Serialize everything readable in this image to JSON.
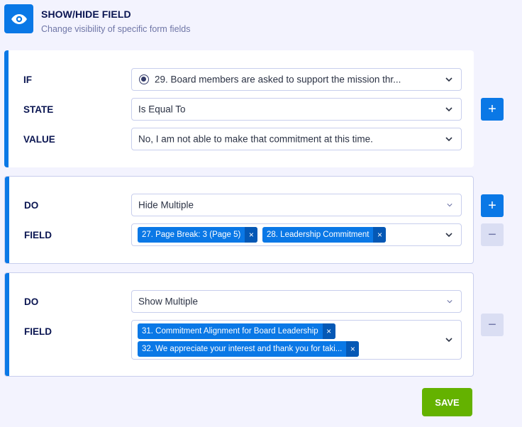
{
  "header": {
    "title": "SHOW/HIDE FIELD",
    "subtitle": "Change visibility of specific form fields",
    "icon": "eye-icon"
  },
  "condition": {
    "if_label": "IF",
    "if_value": "29. Board members are asked to support the mission thr...",
    "state_label": "STATE",
    "state_value": "Is Equal To",
    "value_label": "VALUE",
    "value_value": "No, I am not able to make that commitment at this time."
  },
  "action1": {
    "do_label": "DO",
    "do_value": "Hide Multiple",
    "field_label": "FIELD",
    "tags": [
      "27. Page Break: 3 (Page 5)",
      "28. Leadership Commitment"
    ]
  },
  "action2": {
    "do_label": "DO",
    "do_value": "Show Multiple",
    "field_label": "FIELD",
    "tags": [
      "31. Commitment Alignment for Board Leadership",
      "32. We appreciate your interest and thank you for taki..."
    ]
  },
  "buttons": {
    "add": "+",
    "remove": "−",
    "tag_remove": "×",
    "save": "SAVE"
  },
  "colors": {
    "accent": "#0a78e6",
    "save": "#64b200",
    "background": "#f3f3fe"
  }
}
